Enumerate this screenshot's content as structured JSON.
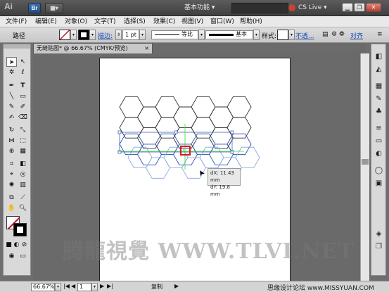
{
  "titlebar": {
    "app_logo": "Ai",
    "br_label": "Br",
    "workspace_label": "基本功能",
    "cslive_label": "CS Live",
    "window_controls": [
      "minimize",
      "restore",
      "close"
    ]
  },
  "menu": {
    "items": [
      "文件(F)",
      "编辑(E)",
      "对象(O)",
      "文字(T)",
      "选择(S)",
      "效果(C)",
      "视图(V)",
      "窗口(W)",
      "帮助(H)"
    ]
  },
  "controlbar": {
    "selection_label": "路径",
    "stroke_label": "描边:",
    "stroke_weight": "1 pt",
    "profile_label": "等比",
    "brush_label": "基本",
    "style_label": "样式:",
    "opacity_label": "不透...",
    "align_label": "对齐"
  },
  "document": {
    "tab_title": "无缝贴图* @ 66.67% (CMYK/预览)"
  },
  "canvas": {
    "tooltip_dx": "dX: 11.43 mm",
    "tooltip_dy": "dY: 19.8 mm",
    "hex_top_color": "#333333",
    "hex_selected_color": "#2a4fb0",
    "hex_blue_color": "#7fa0d8",
    "guide_color": "#2ee02e",
    "handle_color": "#d02020"
  },
  "status": {
    "zoom": "66.67%",
    "page": "1",
    "status_text": "复制"
  },
  "watermark": {
    "text": "腾龍視覺 WWW.TLVI.NET",
    "site": "思缘设计论坛 www.MISSYUAN.COM"
  }
}
